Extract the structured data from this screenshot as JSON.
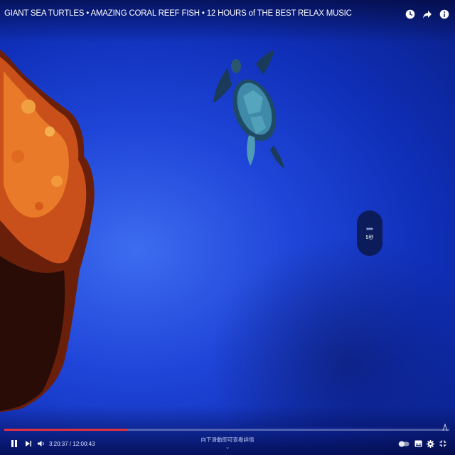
{
  "video": {
    "title": "GIANT SEA TURTLES • AMAZING CORAL REEF FISH • 12 HOURS of THE BEST RELAX MUSIC"
  },
  "top_icons": [
    "watch-later-icon",
    "share-icon",
    "info-icon"
  ],
  "skip_overlay": {
    "label": "5秒"
  },
  "player": {
    "current_time": "3:20:37",
    "separator": " / ",
    "duration": "12:00:43",
    "progress_fraction": 0.278,
    "scroll_hint": "向下滑動即可查看詳情",
    "controls": [
      "pause-icon",
      "next-icon",
      "volume-icon",
      "autoplay-toggle",
      "subtitles-icon",
      "settings-icon",
      "exit-fullscreen-icon"
    ]
  },
  "colors": {
    "accent": "#e03040",
    "water": "#1f45d8"
  }
}
